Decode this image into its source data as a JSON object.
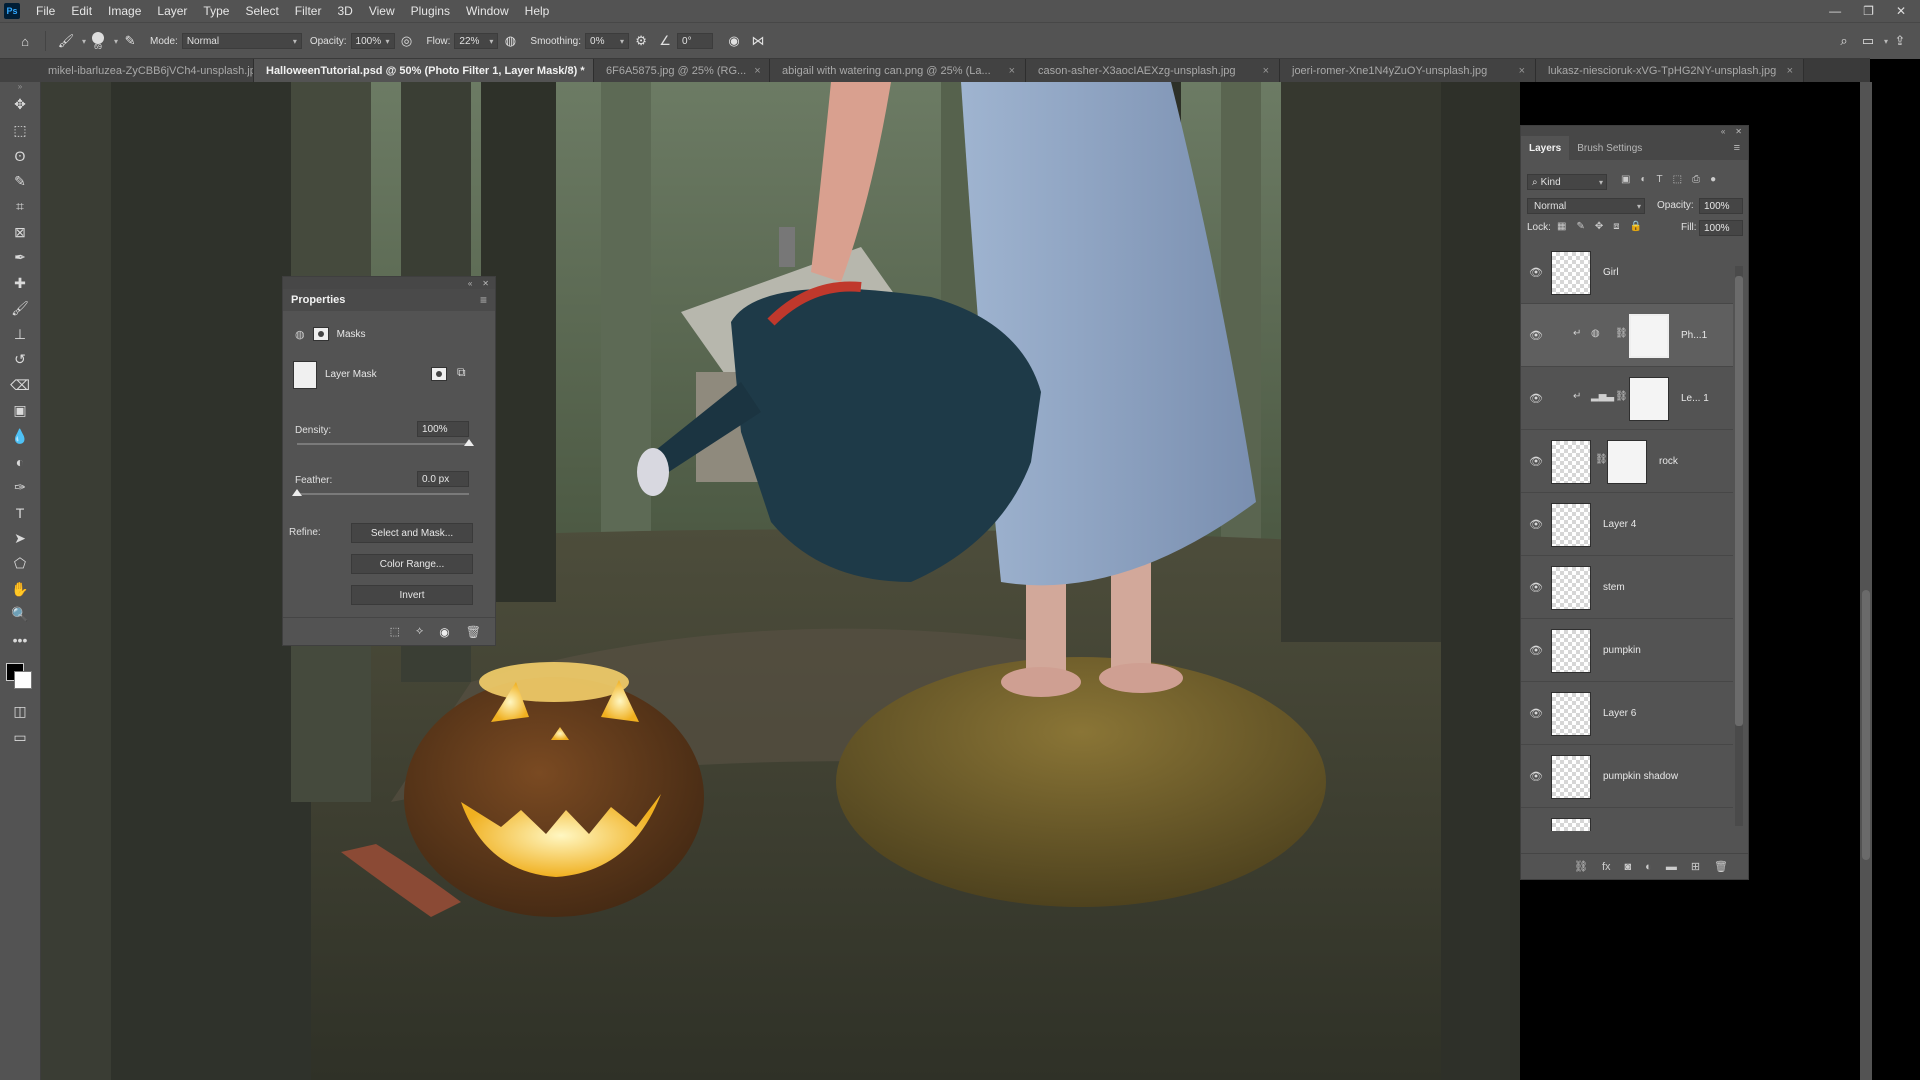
{
  "app": {
    "logo": "Ps",
    "menu": [
      "File",
      "Edit",
      "Image",
      "Layer",
      "Type",
      "Select",
      "Filter",
      "3D",
      "View",
      "Plugins",
      "Window",
      "Help"
    ]
  },
  "options_bar": {
    "brush_size": "69",
    "mode_label": "Mode:",
    "mode_value": "Normal",
    "opacity_label": "Opacity:",
    "opacity_value": "100%",
    "flow_label": "Flow:",
    "flow_value": "22%",
    "smoothing_label": "Smoothing:",
    "smoothing_value": "0%",
    "angle_value": "0°"
  },
  "tabs": [
    {
      "label": "mikel-ibarluzea-ZyCBB6jVCh4-unsplash.jpg",
      "active": false
    },
    {
      "label": "HalloweenTutorial.psd @ 50% (Photo Filter 1, Layer Mask/8) *",
      "active": true
    },
    {
      "label": "6F6A5875.jpg @ 25% (RG...",
      "active": false
    },
    {
      "label": "abigail with watering can.png @ 25% (La...",
      "active": false
    },
    {
      "label": "cason-asher-X3aocIAEXzg-unsplash.jpg",
      "active": false
    },
    {
      "label": "joeri-romer-Xne1N4yZuOY-unsplash.jpg",
      "active": false
    },
    {
      "label": "lukasz-niescioruk-xVG-TpHG2NY-unsplash.jpg",
      "active": false
    }
  ],
  "tools": [
    "move-icon",
    "marquee-icon",
    "lasso-icon",
    "quick-select-icon",
    "crop-icon",
    "frame-icon",
    "eyedropper-icon",
    "healing-icon",
    "brush-icon",
    "stamp-icon",
    "history-brush-icon",
    "eraser-icon",
    "gradient-icon",
    "blur-icon",
    "dodge-icon",
    "pen-icon",
    "type-icon",
    "path-select-icon",
    "shape-icon",
    "hand-icon",
    "zoom-icon",
    "more-icon"
  ],
  "tool_glyphs": [
    "✥",
    "⬚",
    "ʘ",
    "✎",
    "⌗",
    "⊠",
    "✒",
    "✚",
    "🖌",
    "⊥",
    "↺",
    "⌫",
    "▣",
    "💧",
    "◐",
    "✑",
    "T",
    "➤",
    "⬠",
    "✋",
    "🔍",
    "•••"
  ],
  "properties": {
    "title": "Properties",
    "section": "Masks",
    "mask_label": "Layer Mask",
    "density_label": "Density:",
    "density_value": "100%",
    "density_level": 1.0,
    "feather_label": "Feather:",
    "feather_value": "0.0 px",
    "feather_level": 0.0,
    "refine_label": "Refine:",
    "btn_select_mask": "Select and Mask...",
    "btn_color_range": "Color Range...",
    "btn_invert": "Invert"
  },
  "layers_panel": {
    "tab_layers": "Layers",
    "tab_brush": "Brush Settings",
    "filter_kind": "Kind",
    "blend_mode": "Normal",
    "opacity_label": "Opacity:",
    "opacity_value": "100%",
    "lock_label": "Lock:",
    "fill_label": "Fill:",
    "fill_value": "100%",
    "layers": [
      {
        "name": "Girl"
      },
      {
        "name": "Ph...1"
      },
      {
        "name": "Le... 1"
      },
      {
        "name": "rock"
      },
      {
        "name": "Layer 4"
      },
      {
        "name": "stem"
      },
      {
        "name": "pumpkin"
      },
      {
        "name": "Layer 6"
      },
      {
        "name": "pumpkin shadow"
      }
    ]
  }
}
